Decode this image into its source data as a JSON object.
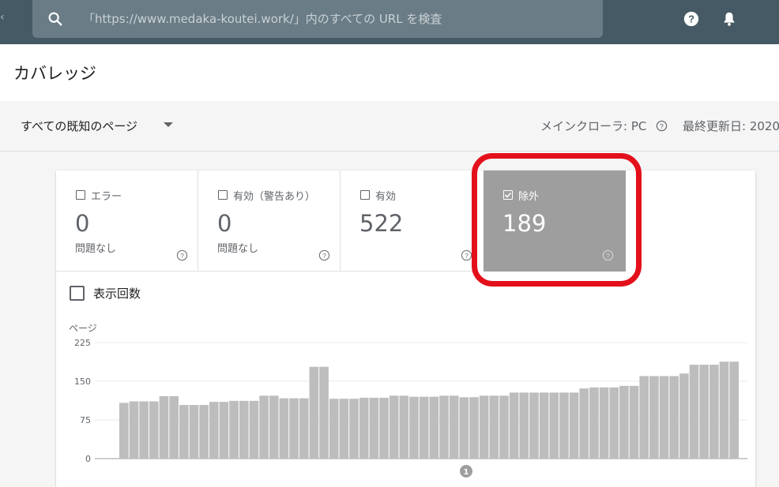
{
  "topbar": {
    "search_placeholder": "「https://www.medaka-koutei.work/」内のすべての URL を検査"
  },
  "header": {
    "title": "カバレッジ"
  },
  "filter": {
    "selected": "すべての既知のページ",
    "crawler": "メインクローラ: PC",
    "updated": "最終更新日: 2020"
  },
  "tiles": [
    {
      "label": "エラー",
      "value": "0",
      "sub": "問題なし",
      "checked": false
    },
    {
      "label": "有効（警告あり）",
      "value": "0",
      "sub": "問題なし",
      "checked": false
    },
    {
      "label": "有効",
      "value": "522",
      "checked": false
    },
    {
      "label": "除外",
      "value": "189",
      "checked": true
    }
  ],
  "impressions_toggle": "表示回数",
  "colors": {
    "topbar": "#455a64",
    "active_tile": "#9e9e9e",
    "bar": "#bdbdbd",
    "highlight": "#e3101b"
  },
  "chart_data": {
    "type": "bar",
    "ylabel": "ページ",
    "yticks": [
      0,
      75,
      150,
      225
    ],
    "ylim": [
      0,
      225
    ],
    "annotation": "1",
    "series": [
      {
        "values": [
          108,
          111,
          111,
          111,
          121,
          121,
          104,
          104,
          104,
          110,
          110,
          112,
          112,
          112,
          122,
          122,
          117,
          117,
          117,
          178,
          178,
          116,
          116,
          116,
          118,
          118,
          118,
          122,
          122,
          120,
          120,
          120,
          122,
          122,
          119,
          119,
          122,
          122,
          122,
          128,
          128,
          128,
          128,
          128,
          128,
          128,
          136,
          138,
          138,
          138,
          141,
          141,
          160,
          160,
          160,
          160,
          165,
          182,
          182,
          182,
          188,
          188
        ]
      }
    ]
  }
}
